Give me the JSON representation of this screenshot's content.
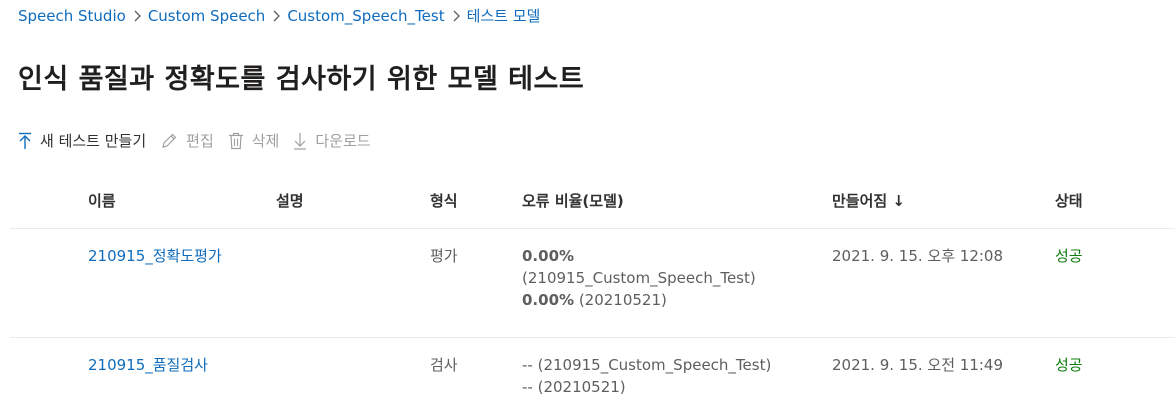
{
  "breadcrumb": {
    "items": [
      {
        "label": "Speech Studio"
      },
      {
        "label": "Custom Speech"
      },
      {
        "label": "Custom_Speech_Test"
      },
      {
        "label": "테스트 모델"
      }
    ],
    "separator": ">"
  },
  "page": {
    "title": "인식 품질과 정확도를 검사하기 위한 모델 테스트"
  },
  "toolbar": {
    "new_test": "새 테스트 만들기",
    "edit": "편집",
    "delete": "삭제",
    "download": "다운로드"
  },
  "table": {
    "headers": {
      "name": "이름",
      "description": "설명",
      "type": "형식",
      "error_rate": "오류 비율(모델)",
      "created": "만들어짐 ↓",
      "status": "상태"
    },
    "rows": [
      {
        "name": "210915_정확도평가",
        "description": "",
        "type": "평가",
        "error_line1_value": "0.00%",
        "error_line2": "(210915_Custom_Speech_Test)",
        "error_line3_value": "0.00%",
        "error_line3_suffix": " (20210521)",
        "created": "2021. 9. 15. 오후 12:08",
        "status": "성공"
      },
      {
        "name": "210915_품질검사",
        "description": "",
        "type": "검사",
        "error_line1": "-- (210915_Custom_Speech_Test)",
        "error_line2": "-- (20210521)",
        "created": "2021. 9. 15. 오전 11:49",
        "status": "성공"
      }
    ]
  },
  "colors": {
    "link": "#0f6cbd",
    "success": "#107c10",
    "disabled": "#a19f9d"
  }
}
